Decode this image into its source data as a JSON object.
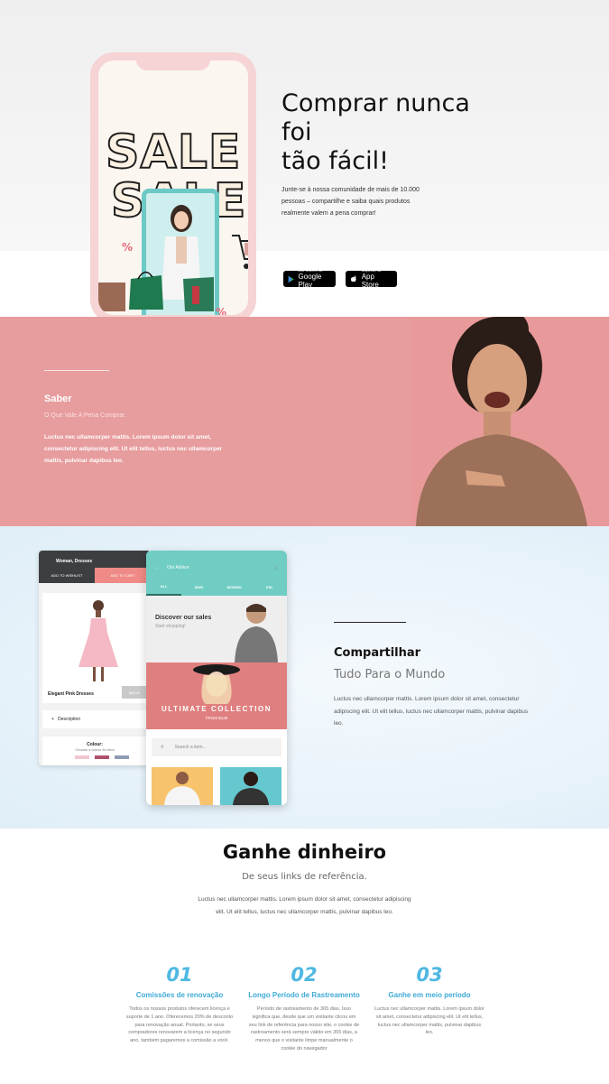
{
  "hero": {
    "title_line1": "Comprar nunca",
    "title_line2": "foi",
    "title_line3": "tão fácil!",
    "description": "Junte-se à nossa comunidade de mais de 10.000 pessoas – compartilhe e saiba quais produtos realmente valem a pena comprar!",
    "sale_word": "SALE",
    "percent_symbol": "%",
    "google_play": {
      "small": "DISPONÍVEL NO",
      "big": "Google Play"
    },
    "app_store": {
      "small": "Disponível na",
      "big": "App Store"
    }
  },
  "saber": {
    "title": "Saber",
    "subtitle": "O Que Vale A Pena Comprar.",
    "body": "Luctus nec ullamcorper mattis. Lorem ipsum dolor sit amet, consectetur adipiscing elit. Ut elit tellus, luctus nec ullamcorper mattis, pulvinar dapibus leo."
  },
  "mock_left": {
    "header": "Woman, Dresses",
    "wishlist_btn": "ADD TO WISHLIST",
    "cart_btn": "ADD TO CART",
    "product_name": "Elegant Pink Dresses",
    "price": "$89.00",
    "description_row": "Description",
    "colour_label": "Colour:",
    "colour_hint": "Choose a colour for item",
    "swatches": [
      "#f1c6cf",
      "#b0506a",
      "#8e9bb3"
    ]
  },
  "mock_right": {
    "app_title": "Our Advice",
    "tabs": [
      "ALL",
      "MAN",
      "WOMAN",
      "KID"
    ],
    "discover_title": "Discover our sales",
    "discover_sub": "Start shopping!",
    "collection_title": "ULTIMATE COLLECTION",
    "collection_sub": "FROM $149",
    "search_placeholder": "Search a item..."
  },
  "share": {
    "title": "Compartilhar",
    "subtitle": "Tudo Para o Mundo",
    "body": "Luctus nec ullamcorper mattis. Lorem ipsum dolor sit amet, consectetur adipiscing elit. Ut elit tellus, luctus nec ullamcorper mattis, pulvinar dapibus leo."
  },
  "earn": {
    "title": "Ganhe dinheiro",
    "subtitle": "De seus links de referência.",
    "body": "Luctus nec ullamcorper mattis. Lorem ipsum dolor sit amet, consectetur adipiscing elit. Ut elit tellus, luctus nec ullamcorper mattis, pulvinar dapibus leo.",
    "columns": [
      {
        "num": "01",
        "title": "Comissões de renovação",
        "text": "Todos os nossos produtos oferecem licença e suporte de 1 ano. Oferecemos 20% de desconto para renovação anual. Portanto, se seus compradores renovarem a licença no segundo ano, também pagaremos a comissão a você."
      },
      {
        "num": "02",
        "title": "Longo Período de Rastreamento",
        "text": "Período de rastreamento de 365 dias. Isso significa que, desde que um visitante clicou em seu link de referência para nosso site, o cookie de rastreamento será sempre válido em 365 dias, a menos que o visitante limpe manualmente o cookie do navegador"
      },
      {
        "num": "03",
        "title": "Ganhe em meio período",
        "text": "Luctus nec ullamcorper mattis. Lorem ipsum dolor sit amet, consectetur adipiscing elit. Ut elit tellus, luctus nec ullamcorper mattis, pulvinar dapibus leo."
      }
    ]
  }
}
